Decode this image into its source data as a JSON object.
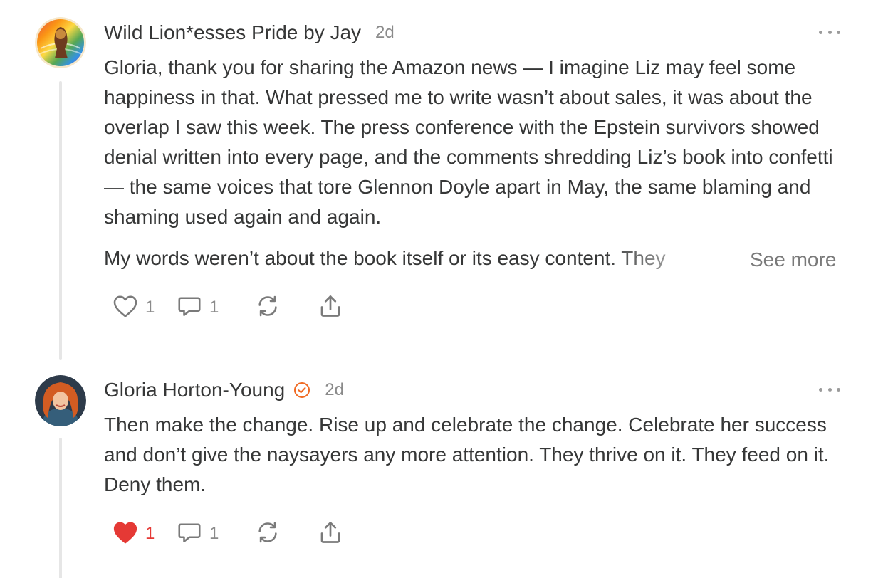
{
  "comments": [
    {
      "author": "Wild Lion*esses Pride by Jay",
      "time": "2d",
      "verified": false,
      "paragraphs": [
        "Gloria, thank you for sharing the Amazon news — I imagine Liz may feel some happiness in that. What pressed me to write wasn’t about sales, it was about the overlap I saw this week. The press conference with the Epstein survivors showed denial written into every page, and the comments shredding Liz’s book into confetti — the same voices that tore Glennon Doyle apart in May, the same blaming and shaming used again and again.",
        "My words weren’t about the book itself or its easy content. They"
      ],
      "see_more": "See more",
      "likes": "1",
      "liked": false,
      "replies": "1",
      "icons": [
        "heart-icon",
        "comment-icon",
        "restack-icon",
        "share-icon",
        "more-icon"
      ]
    },
    {
      "author": "Gloria Horton-Young",
      "time": "2d",
      "verified": true,
      "paragraphs": [
        "Then make the change. Rise up and celebrate the change. Celebrate her success and don’t give the naysayers any more attention. They thrive on it. They feed on it. Deny them."
      ],
      "likes": "1",
      "liked": true,
      "replies": "1",
      "icons": [
        "heart-filled-icon",
        "comment-icon",
        "restack-icon",
        "share-icon",
        "more-icon"
      ]
    }
  ],
  "colors": {
    "text": "#363737",
    "muted": "#8a8a8a",
    "like_active": "#e53935",
    "verified": "#f06a23",
    "thread_line": "#e6e6e6"
  }
}
